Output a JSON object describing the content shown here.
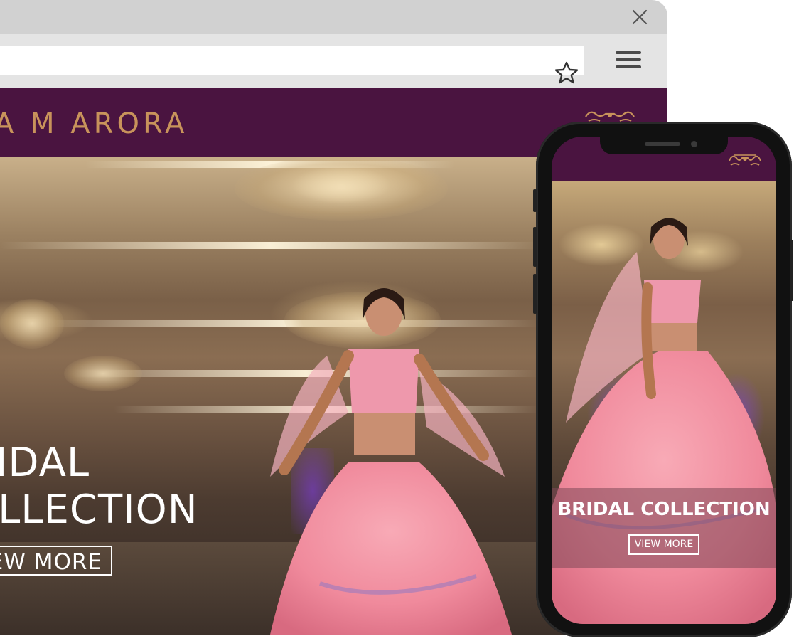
{
  "browser": {
    "close_icon": "close-icon",
    "star_icon": "star-icon",
    "menu_icon": "hamburger-menu-icon"
  },
  "site": {
    "logo_text": "A M ARORA",
    "ornament_icon": "ornament-icon",
    "brand_color": "#4a1440",
    "accent_color": "#c8935b"
  },
  "hero": {
    "title_line1": "RIDAL",
    "title_line2": "OLLECTION",
    "button_label": "EW MORE"
  },
  "mobile": {
    "title": "BRIDAL COLLECTION",
    "button_label": "VIEW MORE"
  }
}
